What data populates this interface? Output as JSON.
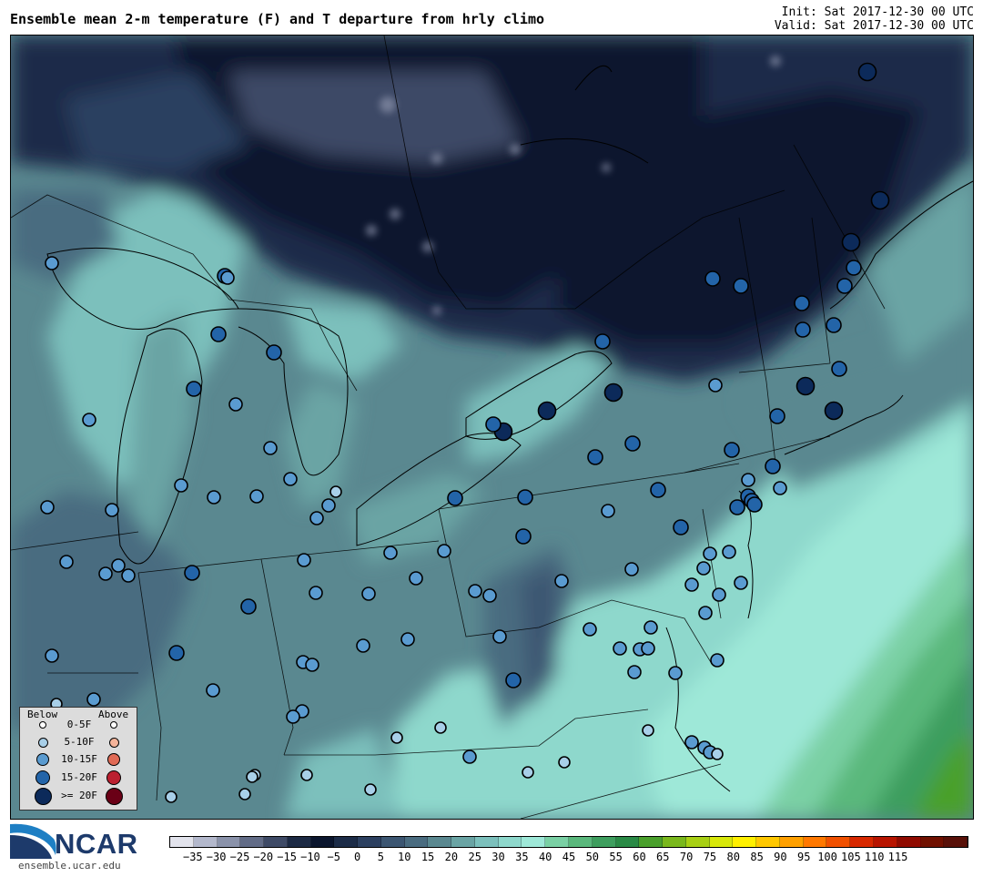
{
  "header": {
    "title": "Ensemble mean 2-m temperature (F) and T departure from hrly climo",
    "init": "Init: Sat 2017-12-30 00 UTC",
    "valid": "Valid: Sat 2017-12-30 00 UTC"
  },
  "legend": {
    "below_label": "Below",
    "above_label": "Above",
    "rows": [
      {
        "label": "0-5F",
        "below_color": "#ffffff",
        "above_color": "#ffffff"
      },
      {
        "label": "5-10F",
        "below_color": "#a8cfe8",
        "above_color": "#f5b49a"
      },
      {
        "label": "10-15F",
        "below_color": "#5a9bd0",
        "above_color": "#e06a55"
      },
      {
        "label": "15-20F",
        "below_color": "#2364a8",
        "above_color": "#bb2030"
      },
      {
        "label": ">= 20F",
        "below_color": "#0c2a5a",
        "above_color": "#6a0016"
      }
    ]
  },
  "colorbar": {
    "colors": [
      "#e2e3ec",
      "#b3b8cc",
      "#8a92aa",
      "#626c87",
      "#3e4a66",
      "#1c2a44",
      "#0b162e",
      "#1c2c48",
      "#2c4060",
      "#3c5672",
      "#4a6c80",
      "#5a8890",
      "#6aa4a4",
      "#7cc0bc",
      "#8ed8cc",
      "#9ee8d8",
      "#7ad0a4",
      "#5ab87c",
      "#3e9e5e",
      "#2a8a46",
      "#4aa02c",
      "#7ab81c",
      "#a8d014",
      "#d8e80a",
      "#fff000",
      "#ffc800",
      "#ffa000",
      "#ff7800",
      "#f05000",
      "#d82800",
      "#b81400",
      "#900a00",
      "#701000",
      "#581008"
    ],
    "tick_labels": [
      "−35",
      "−30",
      "−25",
      "−20",
      "−15",
      "−10",
      "−5",
      "0",
      "5",
      "10",
      "15",
      "20",
      "25",
      "30",
      "35",
      "40",
      "45",
      "50",
      "55",
      "60",
      "65",
      "70",
      "75",
      "80",
      "85",
      "90",
      "95",
      "100",
      "105",
      "110",
      "115"
    ]
  },
  "logo": {
    "wordmark": "NCAR",
    "url": "ensemble.ucar.edu"
  },
  "map": {
    "background_color": "#5a8890",
    "stations": [
      {
        "cat": 4,
        "dir": "below"
      },
      {
        "cat": 4,
        "dir": "below"
      },
      {
        "cat": 4,
        "dir": "below"
      },
      {
        "cat": 4,
        "dir": "below"
      },
      {
        "cat": 3,
        "dir": "below"
      },
      {
        "cat": 3,
        "dir": "below"
      },
      {
        "cat": 3,
        "dir": "below"
      },
      {
        "cat": 2,
        "dir": "below"
      },
      {
        "cat": 1,
        "dir": "below"
      },
      {
        "cat": 0,
        "dir": "below"
      }
    ]
  }
}
